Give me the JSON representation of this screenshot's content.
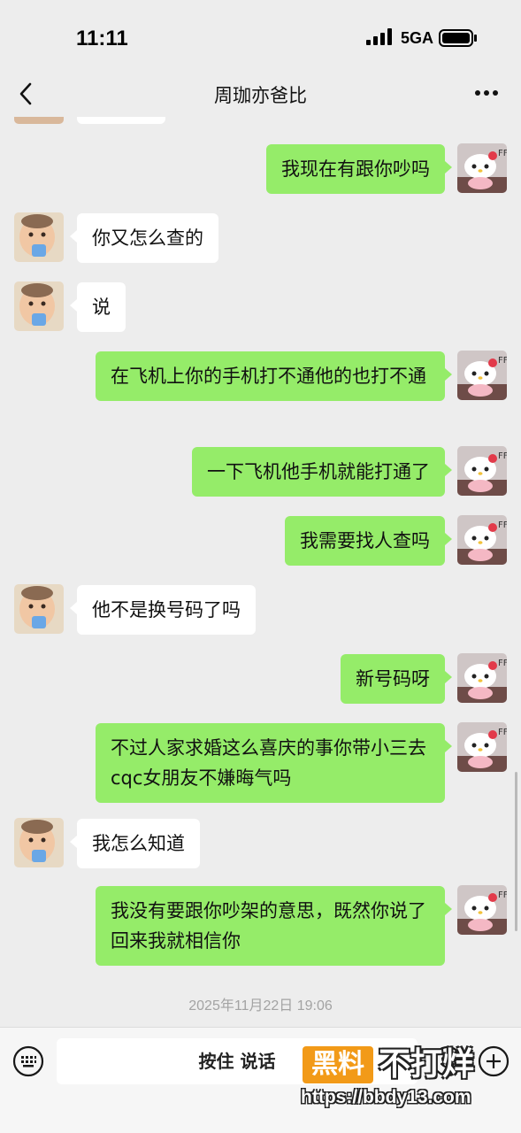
{
  "status_bar": {
    "time": "11:11",
    "network": "5GA"
  },
  "header": {
    "title": "周珈亦爸比"
  },
  "icons": {
    "back": "chevron-left-icon",
    "more": "more-dots-icon",
    "keyboard": "keyboard-icon",
    "emoji": "emoji-icon",
    "plus": "plus-icon"
  },
  "colors": {
    "sent_bubble": "#95ec69",
    "received_bubble": "#ffffff",
    "background": "#ededed"
  },
  "messages": [
    {
      "side": "right",
      "text": "我现在有跟你吵吗"
    },
    {
      "side": "left",
      "text": "你又怎么查的"
    },
    {
      "side": "left",
      "text": "说"
    },
    {
      "side": "right",
      "text": "在飞机上你的手机打不通他的也打不通"
    },
    {
      "side": "right",
      "text": "一下飞机他手机就能打通了"
    },
    {
      "side": "right",
      "text": "我需要找人查吗"
    },
    {
      "side": "left",
      "text": "他不是换号码了吗"
    },
    {
      "side": "right",
      "text": "新号码呀"
    },
    {
      "side": "right",
      "text": "不过人家求婚这么喜庆的事你带小三去cqc女朋友不嫌晦气吗"
    },
    {
      "side": "left",
      "text": "我怎么知道"
    },
    {
      "side": "right",
      "text": "我没有要跟你吵架的意思，既然你说了回来我就相信你"
    }
  ],
  "timestamp": "2025年11月22日 19:06",
  "input_bar": {
    "voice_label": "按住 说话"
  },
  "watermark": {
    "badge": "黑料",
    "text": "不打烊",
    "url": "https://bbdy13.com"
  }
}
